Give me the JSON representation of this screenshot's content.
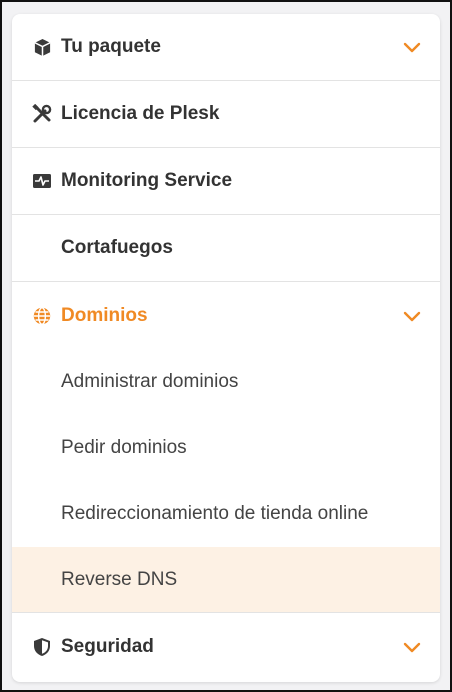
{
  "menu": {
    "items": [
      {
        "label": "Tu paquete",
        "icon": "package-icon",
        "expandable": true
      },
      {
        "label": "Licencia de Plesk",
        "icon": "tools-icon"
      },
      {
        "label": "Monitoring Service",
        "icon": "monitor-pulse-icon"
      },
      {
        "label": "Cortafuegos",
        "icon": ""
      },
      {
        "label": "Dominios",
        "icon": "globe-icon",
        "expandable": true,
        "active": true,
        "subitems": [
          {
            "label": "Administrar dominios"
          },
          {
            "label": "Pedir dominios"
          },
          {
            "label": "Redireccionamiento de tienda online"
          },
          {
            "label": "Reverse DNS",
            "selected": true
          }
        ]
      },
      {
        "label": "Seguridad",
        "icon": "shield-icon",
        "expandable": true
      }
    ]
  },
  "colors": {
    "accent": "#f08a24",
    "selected_bg": "#fdf1e4",
    "text": "#333333",
    "divider": "#e3e3e3"
  }
}
